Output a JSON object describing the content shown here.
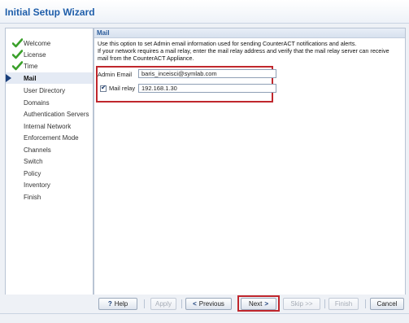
{
  "window": {
    "title": "Initial Setup Wizard"
  },
  "sidebar": {
    "steps": [
      {
        "label": "Welcome",
        "state": "done"
      },
      {
        "label": "License",
        "state": "done"
      },
      {
        "label": "Time",
        "state": "done"
      },
      {
        "label": "Mail",
        "state": "active"
      },
      {
        "label": "User Directory",
        "state": "pending"
      },
      {
        "label": "Domains",
        "state": "pending"
      },
      {
        "label": "Authentication Servers",
        "state": "pending"
      },
      {
        "label": "Internal Network",
        "state": "pending"
      },
      {
        "label": "Enforcement Mode",
        "state": "pending"
      },
      {
        "label": "Channels",
        "state": "pending"
      },
      {
        "label": "Switch",
        "state": "pending"
      },
      {
        "label": "Policy",
        "state": "pending"
      },
      {
        "label": "Inventory",
        "state": "pending"
      },
      {
        "label": "Finish",
        "state": "pending"
      }
    ]
  },
  "main": {
    "section_title": "Mail",
    "description_line1": "Use this option to set Admin email information used for sending CounterACT notifications and alerts.",
    "description_line2": "If your network requires a mail relay, enter the mail relay address and verify that the mail relay server can receive",
    "description_line3": "mail from the CounterACT Appliance.",
    "admin_email_label": "Admin Email",
    "admin_email_value": "baris_inceisci@symlab.com",
    "mail_relay_label": "Mail relay",
    "mail_relay_checked": true,
    "mail_relay_value": "192.168.1.30"
  },
  "buttons": {
    "help": "Help",
    "apply": "Apply",
    "previous": "Previous",
    "next": "Next",
    "skip": "Skip >>",
    "finish": "Finish",
    "cancel": "Cancel"
  },
  "colors": {
    "accent": "#1f5eaa",
    "highlight": "#c0272d",
    "check": "#3aa02a"
  }
}
